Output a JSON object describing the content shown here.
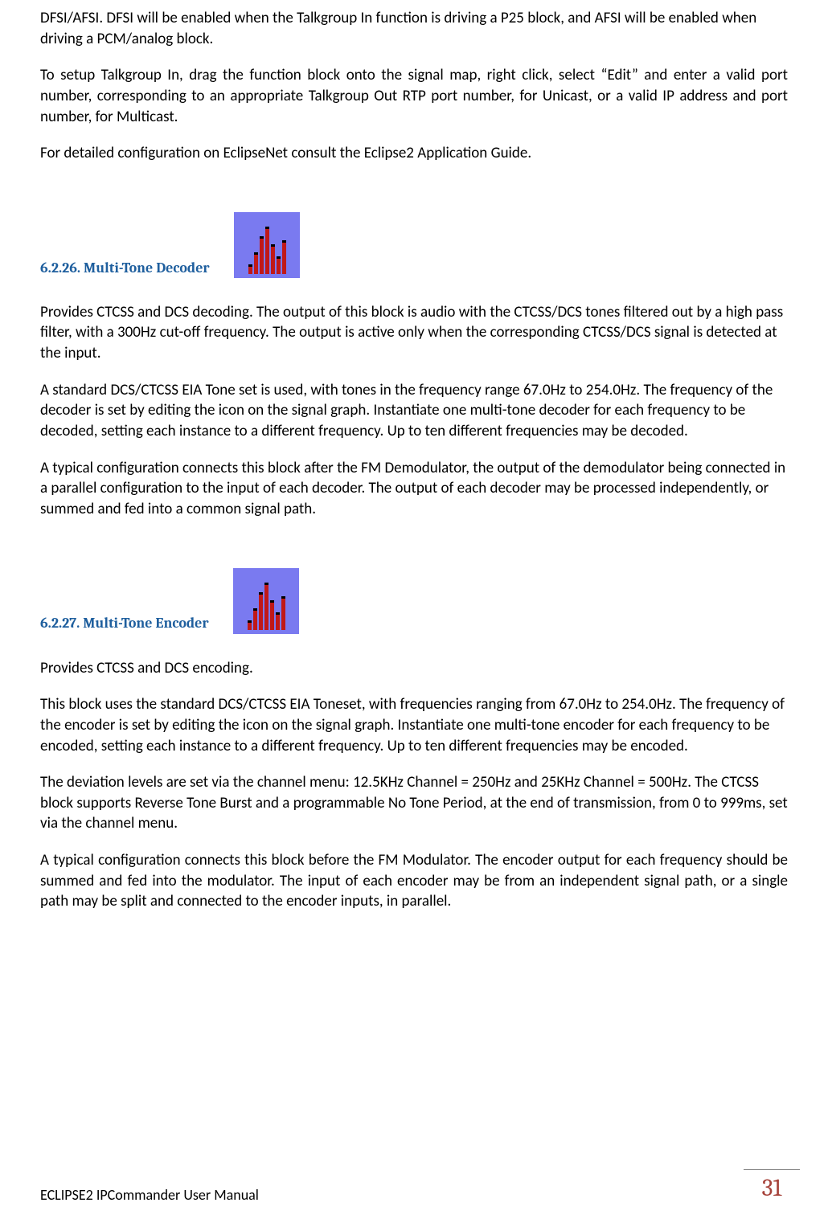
{
  "intro": {
    "p1": "DFSI/AFSI.  DFSI will be enabled when the Talkgroup In function is driving a P25 block, and AFSI will be enabled when driving a PCM/analog block.",
    "p2": "To setup Talkgroup In, drag the function block onto the signal map, right click, select “Edit” and enter a valid port number, corresponding to an appropriate Talkgroup Out RTP port number, for Unicast, or a valid IP address and port number, for Multicast.",
    "p3": "For detailed configuration on EclipseNet consult the Eclipse2 Application Guide."
  },
  "section_decoder": {
    "heading": "6.2.26. Multi-Tone Decoder",
    "p1": "Provides CTCSS and DCS decoding.  The output of this block is audio with the CTCSS/DCS tones filtered out by a high pass filter, with a 300Hz cut-off frequency.  The output is active only when the corresponding CTCSS/DCS signal is detected at the input.",
    "p2": "A standard DCS/CTCSS EIA Tone set is used, with tones in the frequency range 67.0Hz to 254.0Hz.  The frequency of the decoder is set by editing the icon on the signal graph.  Instantiate one multi-tone decoder for each frequency to be decoded, setting each instance to a different frequency.  Up to ten different frequencies may be decoded.",
    "p3": "A typical configuration connects this block after the FM Demodulator, the output of the demodulator being connected in a parallel configuration to the input of each decoder.  The output of each decoder may be processed independently, or summed and fed into a common signal path."
  },
  "section_encoder": {
    "heading": "6.2.27. Multi-Tone Encoder",
    "p1": "Provides CTCSS and DCS encoding.",
    "p2": "This block uses the standard DCS/CTCSS EIA Toneset, with frequencies ranging from 67.0Hz to 254.0Hz.  The frequency of the encoder is set by editing the icon on the signal graph.  Instantiate one multi-tone encoder for each frequency to be encoded, setting each instance to a different frequency.  Up to ten different frequencies may be encoded.",
    "p3": "The deviation levels are set via the channel menu: 12.5KHz Channel = 250Hz and 25KHz Channel = 500Hz.  The CTCSS block supports Reverse Tone Burst and a programmable No Tone Period, at the end of transmission, from 0 to 999ms, set via the channel menu.",
    "p4": "A typical configuration connects this block before the FM Modulator.  The encoder output for each frequency should be summed and fed into the modulator.   The input of each encoder may be from an independent signal path, or a single path may be split and connected to the encoder inputs, in parallel."
  },
  "footer": {
    "title": "ECLIPSE2 IPCommander User Manual",
    "page": "31"
  }
}
